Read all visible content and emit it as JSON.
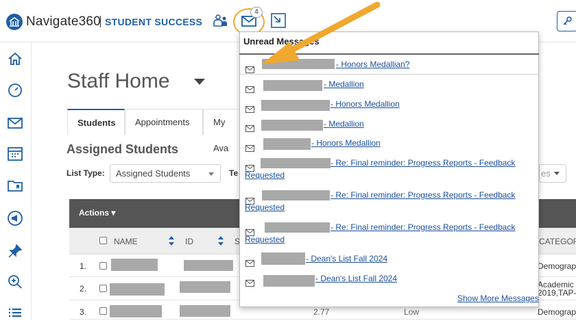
{
  "brand": {
    "name": "Navigate360",
    "subtitle": "STUDENT SUCCESS"
  },
  "topbar": {
    "mail_badge": "4"
  },
  "page": {
    "title": "Staff Home"
  },
  "tabs": [
    {
      "label": "Students"
    },
    {
      "label": "Appointments"
    },
    {
      "label": "My Ava"
    }
  ],
  "section": {
    "title": "Assigned Students"
  },
  "filters": {
    "list_type_label": "List Type:",
    "list_type_value": "Assigned Students",
    "te_label": "Te",
    "right_value": "es"
  },
  "table": {
    "actions_label": "Actions ▾",
    "columns": [
      "NAME",
      "ID",
      "S",
      "CATEGORY"
    ],
    "rows": [
      {
        "num": "1.",
        "gpa": "",
        "risk": "",
        "category": "Demograp"
      },
      {
        "num": "2.",
        "gpa": "",
        "risk": "",
        "category": "Academic",
        "category2": "2019,TAP-"
      },
      {
        "num": "3.",
        "gpa": "2.77",
        "risk": "Low",
        "category": "Demograp"
      }
    ]
  },
  "messages": {
    "header": "Unread Messages",
    "items": [
      {
        "subject": "- Honors Medallian?"
      },
      {
        "subject": "- Medallion"
      },
      {
        "subject": "- Honors Medallion"
      },
      {
        "subject": "- Medallion"
      },
      {
        "subject": "- Honors Medallion"
      },
      {
        "subject": "- Re: Final reminder: Progress Reports - Feedback",
        "subject2": "Requested"
      },
      {
        "subject": "- Re: Final reminder: Progress Reports - Feedback",
        "subject2": "Requested"
      },
      {
        "subject": "- Re: Final reminder: Progress Reports - Feedback",
        "subject2": "Requested"
      },
      {
        "subject": "- Dean's List Fall 2024"
      },
      {
        "subject": "- Dean's List Fall 2024"
      }
    ],
    "show_more": "Show More Messages"
  },
  "colors": {
    "brand_blue": "#1f5fa8",
    "highlight_orange": "#f0a830",
    "link_blue": "#1a4f9c",
    "header_gray": "#555555"
  },
  "icons": [
    "home-icon",
    "dashboard-icon",
    "mail-icon",
    "calendar-icon",
    "folder-icon",
    "megaphone-icon",
    "pin-icon",
    "zoom-icon",
    "list-icon",
    "students-icon",
    "conversations-icon",
    "key-icon"
  ]
}
